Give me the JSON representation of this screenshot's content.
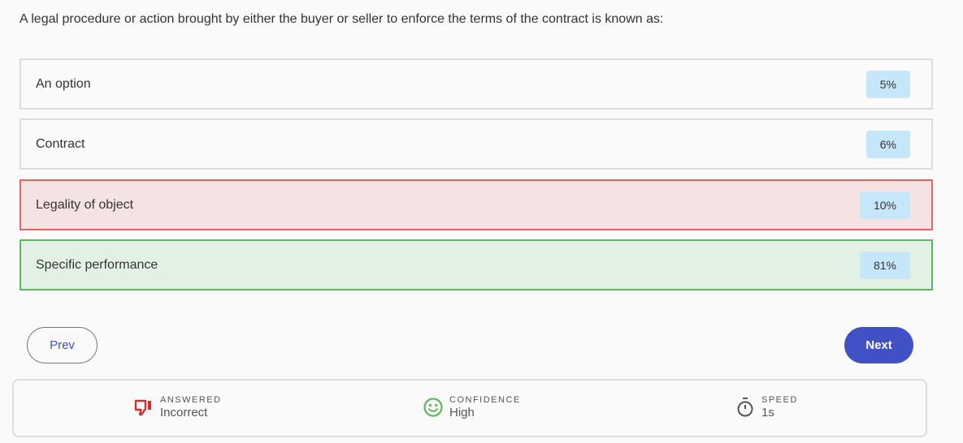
{
  "question": "A legal procedure or action brought by either the buyer or seller to enforce the terms of the contract is known as:",
  "options": [
    {
      "label": "An option",
      "percent": "5%",
      "state": "neutral"
    },
    {
      "label": "Contract",
      "percent": "6%",
      "state": "neutral"
    },
    {
      "label": "Legality of object",
      "percent": "10%",
      "state": "wrong"
    },
    {
      "label": "Specific performance",
      "percent": "81%",
      "state": "correct"
    }
  ],
  "nav": {
    "prev_label": "Prev",
    "next_label": "Next"
  },
  "stats": {
    "answered": {
      "key": "ANSWERED",
      "value": "Incorrect",
      "icon": "thumbs-down-icon",
      "color": "#d32f2f"
    },
    "confidence": {
      "key": "CONFIDENCE",
      "value": "High",
      "icon": "smiley-icon",
      "color": "#5cb85c"
    },
    "speed": {
      "key": "SPEED",
      "value": "1s",
      "icon": "stopwatch-icon",
      "color": "#555555"
    }
  }
}
